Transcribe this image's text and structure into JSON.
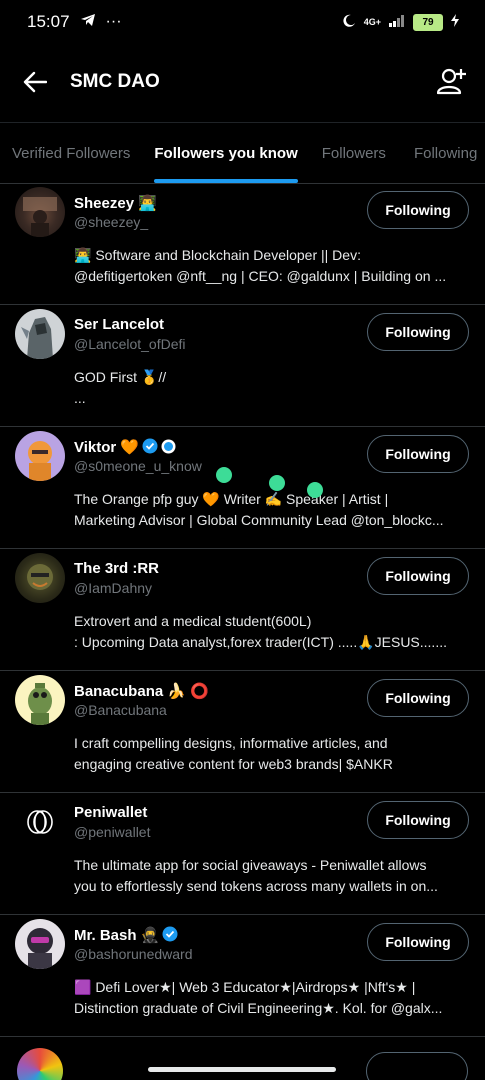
{
  "status_bar": {
    "time": "15:07",
    "network": "4G+",
    "battery": "79"
  },
  "header": {
    "title": "SMC DAO"
  },
  "tabs": [
    "Verified Followers",
    "Followers you know",
    "Followers",
    "Following"
  ],
  "active_tab": "Followers you know",
  "users": [
    {
      "name": "Sheezey 👨‍💻",
      "handle": "@sheezey_",
      "button": "Following",
      "bio": [
        "👨‍💻 Software and Blockchain Developer || Dev:",
        "@defitigertoken @nft__ng | CEO: @galdunx | Building on ..."
      ]
    },
    {
      "name": "Ser Lancelot",
      "handle": "@Lancelot_ofDefi",
      "button": "Following",
      "bio": [
        "GOD First 🥇//",
        "..."
      ]
    },
    {
      "name": "Viktor 🧡",
      "handle": "@s0meone_u_know",
      "button": "Following",
      "bio": [
        "The Orange pfp guy 🧡 Writer ✍️ Speaker | Artist |",
        "Marketing Advisor | Global Community Lead @ton_blockc..."
      ]
    },
    {
      "name": "The 3rd :RR",
      "handle": "@IamDahny",
      "button": "Following",
      "bio": [
        "Extrovert and a medical student(600L)",
        ": Upcoming Data analyst,forex trader(ICT) .....🙏JESUS......."
      ]
    },
    {
      "name": "Banacubana 🍌 ⭕",
      "handle": "@Banacubana",
      "button": "Following",
      "bio": [
        "I craft compelling designs, informative articles, and",
        "engaging creative content for web3 brands| $ANKR"
      ]
    },
    {
      "name": "Peniwallet",
      "handle": "@peniwallet",
      "button": "Following",
      "bio": [
        "The ultimate app for social giveaways - Peniwallet allows",
        "you to effortlessly send tokens across many wallets in on..."
      ]
    },
    {
      "name": "Mr. Bash 🥷",
      "handle": "@bashorunedward",
      "button": "Following",
      "bio": [
        "🟪 Defi Lover★| Web 3 Educator★|Airdrops★ |Nft's★ |",
        "Distinction graduate of Civil Engineering★. Kol. for @galx..."
      ]
    }
  ],
  "colors": {
    "accent": "#1d9bf0",
    "verified": "#1d9bf0",
    "dots": "#3ddc97"
  }
}
